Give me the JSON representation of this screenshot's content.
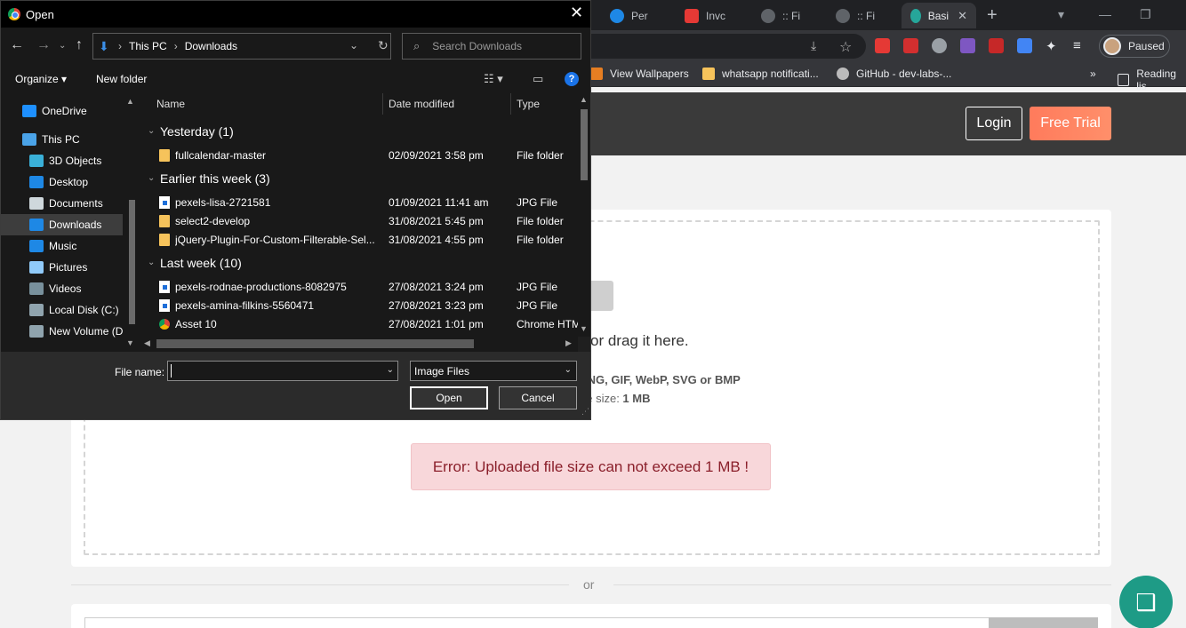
{
  "browser": {
    "tabs": [
      {
        "label": "Per",
        "color": "#1e88e5"
      },
      {
        "label": "Invc",
        "color": "#e53935"
      },
      {
        "label": ":: Fi",
        "color": "#9aa0a6"
      },
      {
        "label": ":: Fi",
        "color": "#9aa0a6"
      },
      {
        "label": "Basi",
        "color": "#26a69a"
      }
    ],
    "new_tab": "+",
    "profile_status": "Paused",
    "bookmarks": [
      "View Wallpapers",
      "whatsapp notificati...",
      "GitHub - dev-labs-...",
      "Reading lis"
    ],
    "more": "»"
  },
  "site": {
    "login": "Login",
    "free_trial": "Free Trial",
    "drag_text": "or drag it here.",
    "formats_text": "PNG, GIF, WebP, SVG or BMP",
    "max_size_prefix": "ge size: ",
    "max_size_value": "1 MB",
    "error": "Error: Uploaded file size can not exceed 1 MB !",
    "or": "or"
  },
  "dialog": {
    "title": "Open",
    "path": [
      "This PC",
      "Downloads"
    ],
    "search_placeholder": "Search Downloads",
    "organize": "Organize",
    "new_folder": "New folder",
    "help": "?",
    "nav_items": [
      {
        "label": "OneDrive",
        "color": "#1e90ff"
      },
      {
        "label": "This PC",
        "color": "#4aa3e8"
      },
      {
        "label": "3D Objects",
        "color": "#3ab0d8"
      },
      {
        "label": "Desktop",
        "color": "#1e88e5"
      },
      {
        "label": "Documents",
        "color": "#cfd8dc"
      },
      {
        "label": "Downloads",
        "color": "#1e88e5"
      },
      {
        "label": "Music",
        "color": "#1e88e5"
      },
      {
        "label": "Pictures",
        "color": "#90caf9"
      },
      {
        "label": "Videos",
        "color": "#78909c"
      },
      {
        "label": "Local Disk (C:)",
        "color": "#90a4ae"
      },
      {
        "label": "New Volume (D:",
        "color": "#90a4ae"
      }
    ],
    "columns": [
      "Name",
      "Date modified",
      "Type"
    ],
    "groups": [
      {
        "title": "Yesterday (1)",
        "files": [
          {
            "name": "fullcalendar-master",
            "date": "02/09/2021 3:58 pm",
            "type": "File folder",
            "icon": "folder"
          }
        ]
      },
      {
        "title": "Earlier this week (3)",
        "files": [
          {
            "name": "pexels-lisa-2721581",
            "date": "01/09/2021 11:41 am",
            "type": "JPG File",
            "icon": "jpg"
          },
          {
            "name": "select2-develop",
            "date": "31/08/2021 5:45 pm",
            "type": "File folder",
            "icon": "folder"
          },
          {
            "name": "jQuery-Plugin-For-Custom-Filterable-Sel...",
            "date": "31/08/2021 4:55 pm",
            "type": "File folder",
            "icon": "folder"
          }
        ]
      },
      {
        "title": "Last week (10)",
        "files": [
          {
            "name": "pexels-rodnae-productions-8082975",
            "date": "27/08/2021 3:24 pm",
            "type": "JPG File",
            "icon": "jpg"
          },
          {
            "name": "pexels-amina-filkins-5560471",
            "date": "27/08/2021 3:23 pm",
            "type": "JPG File",
            "icon": "jpg"
          },
          {
            "name": "Asset 10",
            "date": "27/08/2021 1:01 pm",
            "type": "Chrome HTM",
            "icon": "chrome"
          }
        ]
      }
    ],
    "file_name_label": "File name:",
    "file_name_value": "",
    "file_type": "Image Files",
    "open": "Open",
    "cancel": "Cancel"
  }
}
